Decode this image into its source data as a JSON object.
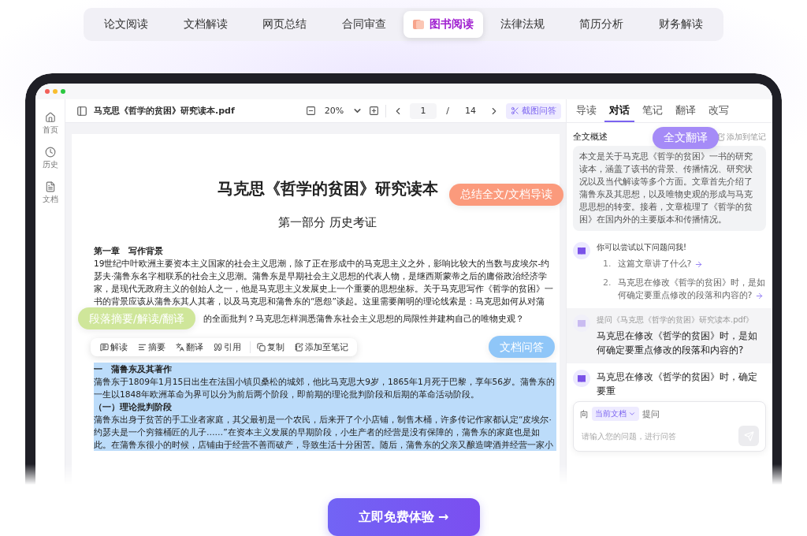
{
  "tabs": [
    {
      "label": "论文阅读",
      "selected": false
    },
    {
      "label": "文档解读",
      "selected": false
    },
    {
      "label": "网页总结",
      "selected": false
    },
    {
      "label": "合同审查",
      "selected": false
    },
    {
      "label": "图书阅读",
      "selected": true
    },
    {
      "label": "法律法规",
      "selected": false
    },
    {
      "label": "简历分析",
      "selected": false
    },
    {
      "label": "财务解读",
      "selected": false
    }
  ],
  "sidebar": {
    "items": [
      {
        "kind": "home",
        "label": "首页"
      },
      {
        "kind": "history",
        "label": "历史"
      },
      {
        "kind": "document",
        "label": "文档"
      }
    ]
  },
  "toolbar": {
    "filename": "马克思《哲学的贫困》研究读本.pdf",
    "zoom": "20%",
    "page": "1",
    "page_separator": "/",
    "page_total": "14",
    "snip_button": "截图问答"
  },
  "document": {
    "title": "马克思《哲学的贫困》研究读本",
    "subtitle": "第一部分 历史考证",
    "sections": [
      {
        "kind": "heading",
        "text": "第一章　写作背景",
        "highlighted": false
      },
      {
        "kind": "text",
        "text": "19世纪中叶欧洲主要资本主义国家的社会主义思潮，除了正在形成中的马克思主义之外，影响比较大的当数与皮埃尔-约瑟夫·蒲鲁东名字相联系的社会主义思潮。蒲鲁东是早期社会主义思想的代表人物，是继西斯蒙蒂之后的庸俗政治经济学家，是现代无政府主义的创始人之一，他是马克思主义发展史上一个重要的思想坐标。关于马克思写作《哲学的贫困》一书的背景应该从蒲鲁东其人其著，以及马克思和蒲鲁东的“恩怨”谈起。这里需要阐明的理论线索是：马克思如何从对蒲",
        "highlighted": false
      },
      {
        "kind": "continuation",
        "text": "的全面批判？马克思怎样洞悉蒲鲁东社会主义思想的局限性并建构自己的唯物史观？",
        "highlighted": false
      },
      {
        "kind": "heading",
        "text": "一　蒲鲁东及其著作",
        "highlighted": true
      },
      {
        "kind": "text",
        "text": "蒲鲁东于1809年1月15日出生在法国小镇贝桑松的城郊，他比马克思大9岁，1865年1月死于巴黎，享年56岁。蒲鲁东的一生以1848年欧洲革命为界可以分为前后两个阶段，即前期的理论批判阶段和后期的革命活动阶段。",
        "highlighted": true
      },
      {
        "kind": "heading",
        "text": "（一）理论批判阶段",
        "highlighted": true
      },
      {
        "kind": "text",
        "text": "蒲鲁东出身于贫苦的手工业者家庭，其父最初是一个农民，后来开了个小店铺，制售木桶，许多传记作家都认定“皮埃尔·约瑟夫是一个穷箍桶匠的儿子……”在资本主义发展的早期阶段，小生产者的经营是没有保障的，蒲鲁东的家庭也是如此。在蒲鲁东很小的时候，店铺由于经营不善而破产，导致生活十分困苦。随后，蒲鲁东的父亲又酿造啤酒并经营一家小",
        "highlighted": true
      }
    ]
  },
  "selection_toolbar": {
    "actions": [
      {
        "kind": "explain",
        "label": "解读",
        "divider_before": false
      },
      {
        "kind": "summary",
        "label": "摘要",
        "divider_before": false
      },
      {
        "kind": "translate",
        "label": "翻译",
        "divider_before": false
      },
      {
        "kind": "quote",
        "label": "引用",
        "divider_before": false
      },
      {
        "kind": "copy",
        "label": "复制",
        "divider_before": true
      },
      {
        "kind": "note",
        "label": "添加至笔记",
        "divider_before": false
      }
    ]
  },
  "panel": {
    "tabs": [
      {
        "label": "导读",
        "selected": false
      },
      {
        "label": "对话",
        "selected": true
      },
      {
        "label": "笔记",
        "selected": false
      },
      {
        "label": "翻译",
        "selected": false
      },
      {
        "label": "改写",
        "selected": false
      }
    ],
    "summary": {
      "label": "全文概述",
      "add_note": "添加到笔记",
      "text": "本文是关于马克思《哲学的贫困》一书的研究读本，涵盖了该书的背景、传播情况、研究状况以及当代解读等多个方面。文章首先介绍了蒲鲁东及其思想，以及唯物史观的形成与马克思思想的转变。接着，文章梳理了《哲学的贫困》在国内外的主要版本和传播情况。"
    },
    "suggestions": {
      "intro": "你可以尝试以下问题问我!",
      "items": [
        {
          "number": "1.",
          "text": "这篇文章讲了什么?"
        },
        {
          "number": "2.",
          "text": "马克思在修改《哲学的贫困》时，是如何确定要重点修改的段落和内容的?"
        }
      ]
    },
    "question": {
      "source": "提问《马克思《哲学的贫困》研究读本.pdf》",
      "text": "马克思在修改《哲学的贫困》时，是如何确定要重点修改的段落和内容的?"
    },
    "answer": {
      "text": "马克思在修改《哲学的贫困》时，确定要重"
    },
    "input": {
      "prefix": "向",
      "scope": "当前文档",
      "suffix": "提问",
      "placeholder": "请输入您的问题，进行问答"
    }
  },
  "callouts": [
    {
      "kind": "translate",
      "text": "全文翻译",
      "color": "#a58bf7"
    },
    {
      "kind": "summary",
      "text": "总结全文/文档导读",
      "color": "#fb9a7c"
    },
    {
      "kind": "paragraph",
      "text": "段落摘要/解读/翻译",
      "color": "#cfe69a"
    },
    {
      "kind": "qa",
      "text": "文档问答",
      "color": "#8fc6f8"
    }
  ],
  "cta": "立即免费体验 →"
}
